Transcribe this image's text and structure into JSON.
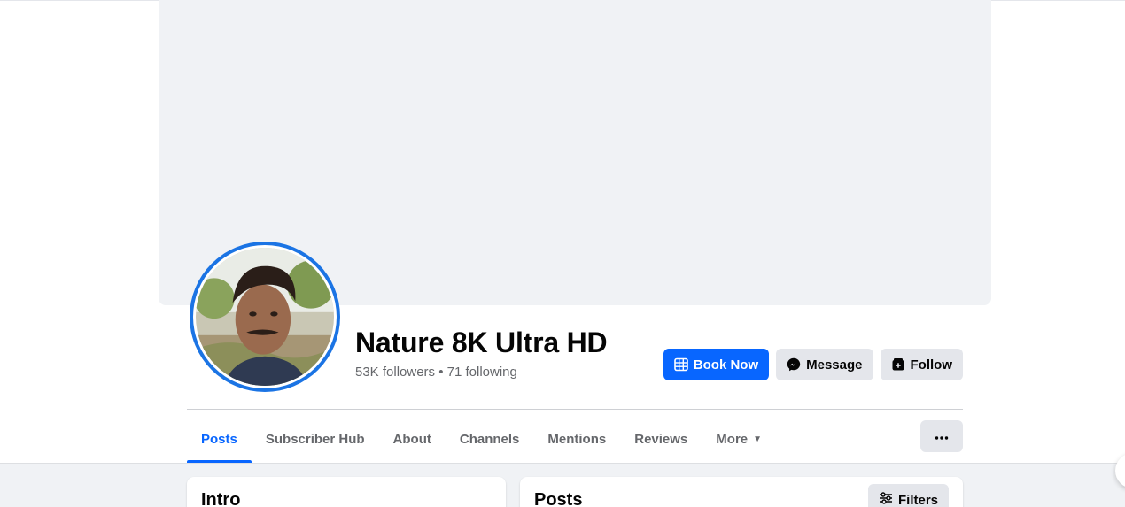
{
  "profile": {
    "name": "Nature 8K Ultra HD",
    "followers": "53K followers",
    "separator": " • ",
    "following": "71 following"
  },
  "actions": {
    "book_now": "Book Now",
    "message": "Message",
    "follow": "Follow"
  },
  "tabs": [
    {
      "label": "Posts",
      "active": true
    },
    {
      "label": "Subscriber Hub",
      "active": false
    },
    {
      "label": "About",
      "active": false
    },
    {
      "label": "Channels",
      "active": false
    },
    {
      "label": "Mentions",
      "active": false
    },
    {
      "label": "Reviews",
      "active": false
    },
    {
      "label": "More",
      "active": false
    }
  ],
  "sections": {
    "intro_title": "Intro",
    "posts_title": "Posts",
    "filters_label": "Filters"
  },
  "colors": {
    "accent": "#0866ff",
    "cover_bg": "#f0f2f5",
    "secondary_button": "#e4e6eb",
    "muted_text": "#65676b"
  },
  "icons": {
    "book_now": "calendar-grid-icon",
    "message": "messenger-icon",
    "follow": "follow-icon",
    "more_tab": "caret-down-icon",
    "more_options": "ellipsis-icon",
    "filters": "sliders-icon"
  }
}
